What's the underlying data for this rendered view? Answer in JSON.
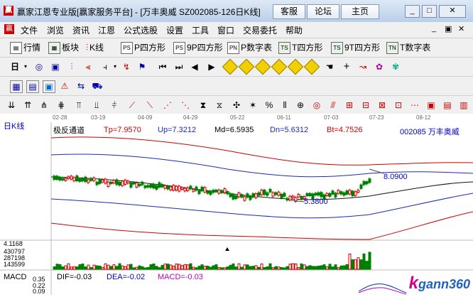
{
  "titlebar": {
    "title": "赢家江恩专业版[赢家服务平台] - [万丰奥威  SZ002085-126日K线]",
    "buttons": [
      "客服",
      "论坛",
      "主页"
    ]
  },
  "menu": [
    "文件",
    "浏览",
    "资讯",
    "江恩",
    "公式选股",
    "设置",
    "工具",
    "窗口",
    "交易委托",
    "帮助"
  ],
  "toolbar1": [
    "行情",
    "板块",
    "K线",
    "P四方形",
    "9P四方形",
    "P数字表",
    "T四方形",
    "9T四方形",
    "T数字表"
  ],
  "dates": [
    "02-28",
    "03-19",
    "04-09",
    "04-29",
    "05-22",
    "06-11",
    "07-03",
    "07-23",
    "08-12"
  ],
  "chart": {
    "period_label": "日K线",
    "indicator": "极反通道",
    "tp": "Tp=7.9570",
    "up": "Up=7.3212",
    "md": "Md=6.5935",
    "dn": "Dn=5.6312",
    "bt": "Bt=4.7526",
    "stock": "002085  万丰奥威",
    "price_high_label": "8.0900",
    "price_low_label": "5.3800",
    "volume_axis": [
      "4.1168",
      "430797",
      "287198",
      "143599"
    ],
    "macd_label": "MACD",
    "dif": "DIF=-0.03",
    "dea": "DEA=-0.02",
    "macd": "MACD=-0.03",
    "macd_axis": [
      "0.35",
      "0.22",
      "0.09"
    ]
  },
  "watermark": "gann360"
}
